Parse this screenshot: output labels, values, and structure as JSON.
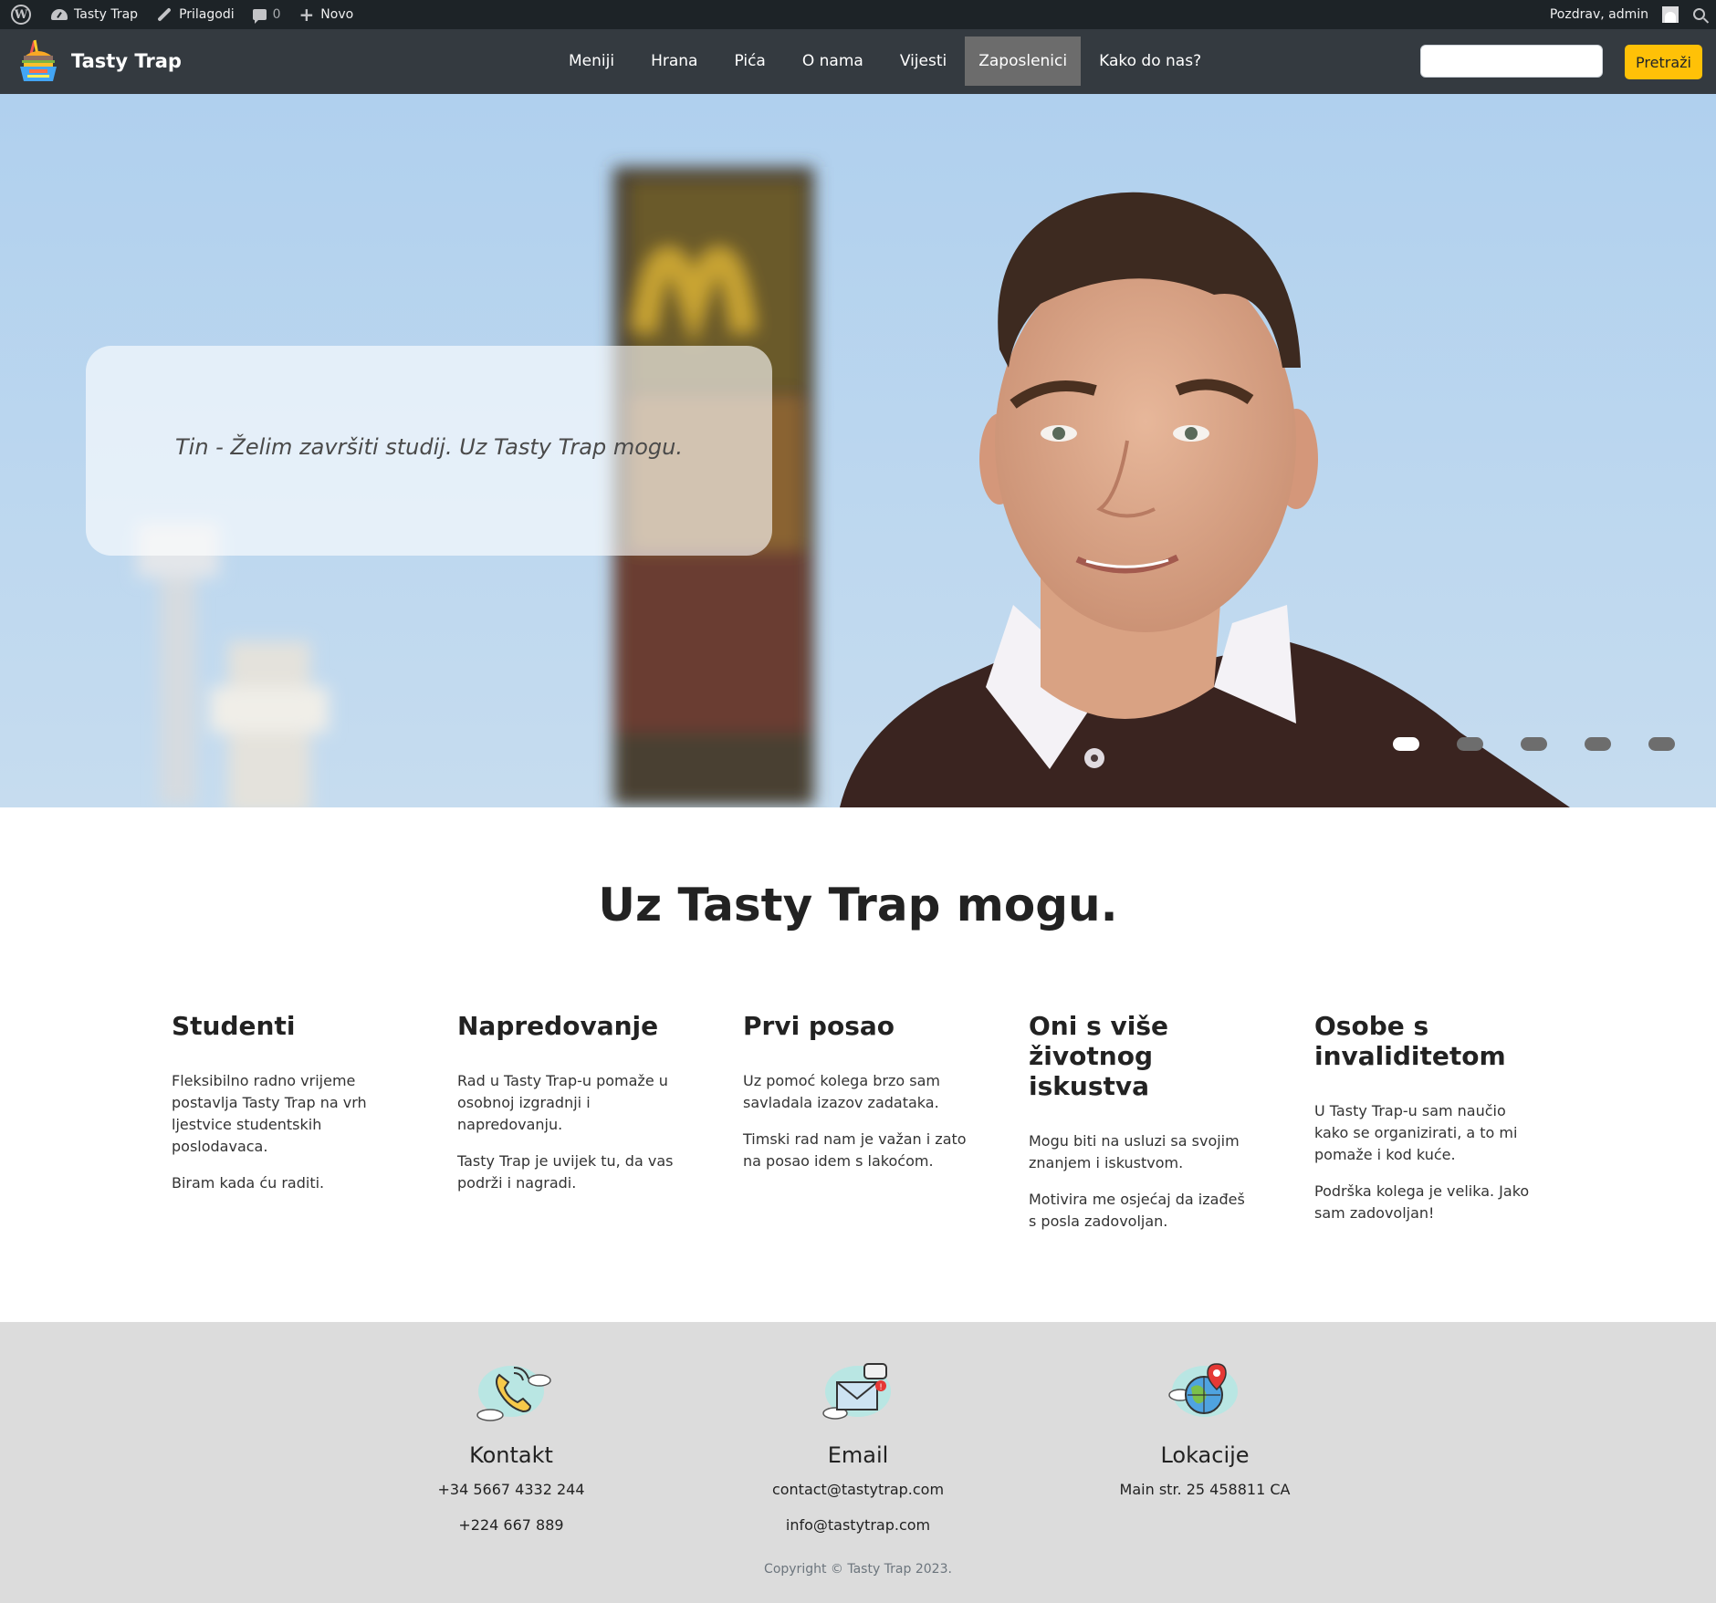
{
  "adminbar": {
    "site_name": "Tasty Trap",
    "customize": "Prilagodi",
    "comments_count": "0",
    "new": "Novo",
    "greeting": "Pozdrav, admin"
  },
  "navbar": {
    "brand": "Tasty Trap",
    "items": [
      {
        "label": "Meniji"
      },
      {
        "label": "Hrana"
      },
      {
        "label": "Pića"
      },
      {
        "label": "O nama"
      },
      {
        "label": "Vijesti"
      },
      {
        "label": "Zaposlenici",
        "active": true
      },
      {
        "label": "Kako do nas?"
      }
    ],
    "search_value": "",
    "search_button": "Pretraži",
    "accent": "#ffc107"
  },
  "hero": {
    "caption": "Tin - Želim završiti studij. Uz Tasty Trap mogu.",
    "slide_count": 5,
    "active_slide": 1
  },
  "main": {
    "title": "Uz Tasty Trap mogu.",
    "features": [
      {
        "title": "Studenti",
        "paragraphs": [
          "Fleksibilno radno vrijeme postavlja Tasty Trap na vrh ljestvice studentskih poslodavaca.",
          "Biram kada ću raditi."
        ]
      },
      {
        "title": "Napredovanje",
        "paragraphs": [
          "Rad u Tasty Trap-u pomaže u osobnoj izgradnji i napredovanju.",
          "Tasty Trap je uvijek tu, da vas podrži i nagradi."
        ]
      },
      {
        "title": "Prvi posao",
        "paragraphs": [
          "Uz pomoć kolega brzo sam savladala izazov zadataka.",
          "Timski rad nam je važan i zato na posao idem s lakoćom."
        ]
      },
      {
        "title": "Oni s više životnog iskustva",
        "paragraphs": [
          "Mogu biti na usluzi sa svojim znanjem i iskustvom.",
          "Motivira me osjećaj da izađeš s posla zadovoljan."
        ]
      },
      {
        "title": "Osobe s invaliditetom",
        "paragraphs": [
          "U Tasty Trap-u sam naučio kako se organizirati, a to mi pomaže i kod kuće.",
          "Podrška kolega je velika. Jako sam zadovoljan!"
        ]
      }
    ]
  },
  "footer": {
    "contact": {
      "title": "Kontakt",
      "lines": [
        "+34 5667 4332 244",
        "+224 667 889"
      ],
      "icon": "phone-icon"
    },
    "email": {
      "title": "Email",
      "lines": [
        "contact@tastytrap.com",
        "info@tastytrap.com"
      ],
      "icon": "envelope-icon"
    },
    "locations": {
      "title": "Lokacije",
      "lines": [
        "Main str. 25 458811 CA"
      ],
      "icon": "globe-pin-icon"
    },
    "copyright": "Copyright © Tasty Trap 2023."
  }
}
